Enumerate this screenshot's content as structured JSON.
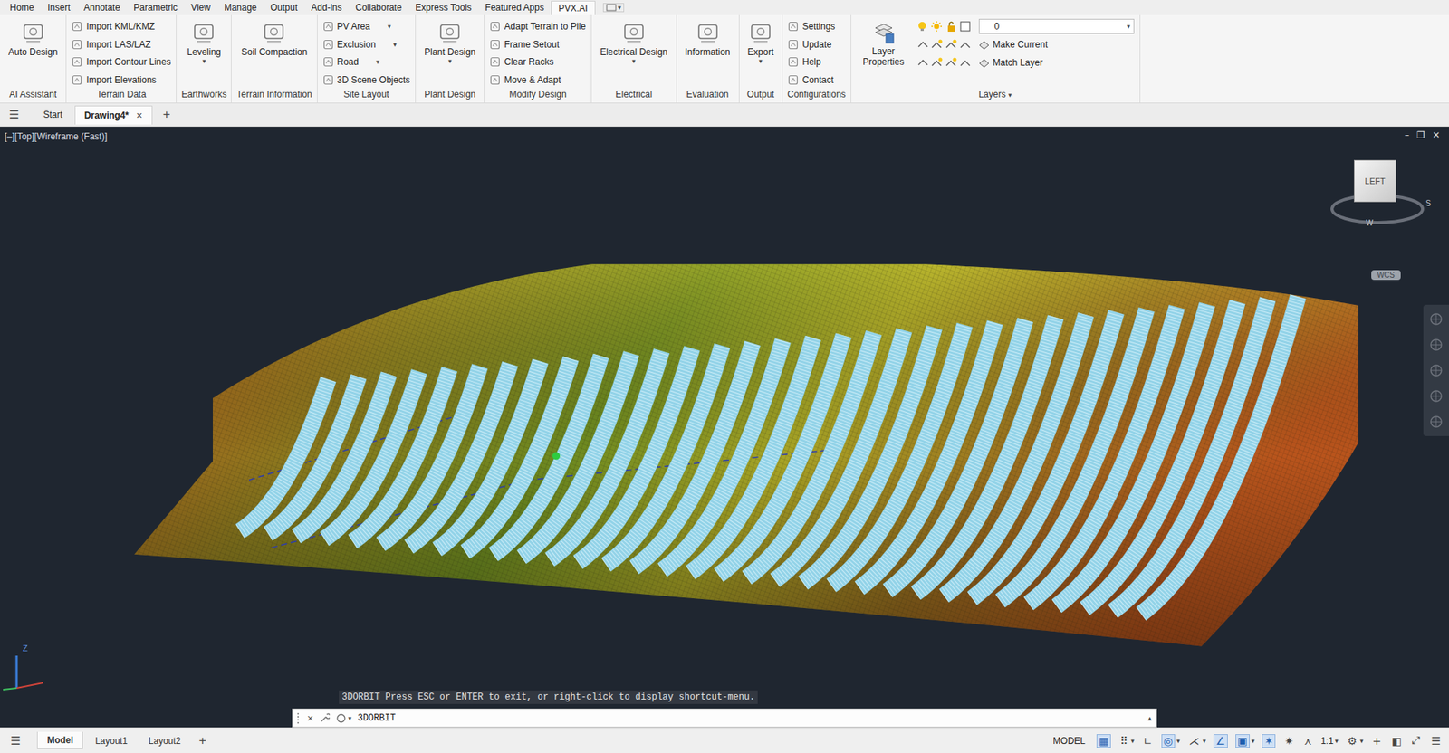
{
  "menu_tabs": [
    {
      "label": "Home",
      "selected": false
    },
    {
      "label": "Insert",
      "selected": false
    },
    {
      "label": "Annotate",
      "selected": false
    },
    {
      "label": "Parametric",
      "selected": false
    },
    {
      "label": "View",
      "selected": false
    },
    {
      "label": "Manage",
      "selected": false
    },
    {
      "label": "Output",
      "selected": false
    },
    {
      "label": "Add-ins",
      "selected": false
    },
    {
      "label": "Collaborate",
      "selected": false
    },
    {
      "label": "Express Tools",
      "selected": false
    },
    {
      "label": "Featured Apps",
      "selected": false
    },
    {
      "label": "PVX.AI",
      "selected": true
    }
  ],
  "menu_extra": "▾",
  "ribbon_groups": [
    {
      "title": "AI Assistant",
      "kind": "large",
      "items": [
        {
          "label": "Auto Design",
          "arrow": ""
        }
      ]
    },
    {
      "title": "Terrain Data",
      "kind": "small",
      "items": [
        {
          "label": "Import KML/KMZ",
          "arrow": ""
        },
        {
          "label": "Import LAS/LAZ",
          "arrow": ""
        },
        {
          "label": "Import Contour Lines",
          "arrow": ""
        },
        {
          "label": "Import Elevations",
          "arrow": ""
        }
      ]
    },
    {
      "title": "Earthworks",
      "kind": "large",
      "items": [
        {
          "label": "Leveling",
          "arrow": "▾"
        }
      ]
    },
    {
      "title": "Terrain Information",
      "kind": "large",
      "items": [
        {
          "label": "Soil Compaction",
          "arrow": ""
        }
      ]
    },
    {
      "title": "Site Layout",
      "kind": "small",
      "items": [
        {
          "label": "PV Area",
          "arrow": "▾"
        },
        {
          "label": "Exclusion",
          "arrow": "▾"
        },
        {
          "label": "Road",
          "arrow": "▾"
        },
        {
          "label": "3D Scene Objects",
          "arrow": ""
        }
      ]
    },
    {
      "title": "Plant Design",
      "kind": "large",
      "items": [
        {
          "label": "Plant Design",
          "arrow": "▾"
        }
      ]
    },
    {
      "title": "Modify Design",
      "kind": "small",
      "items": [
        {
          "label": "Adapt Terrain to Pile",
          "arrow": ""
        },
        {
          "label": "Frame Setout",
          "arrow": ""
        },
        {
          "label": "Clear Racks",
          "arrow": ""
        },
        {
          "label": "Move & Adapt",
          "arrow": ""
        }
      ]
    },
    {
      "title": "Electrical",
      "kind": "large",
      "items": [
        {
          "label": "Electrical Design",
          "arrow": "▾"
        }
      ]
    },
    {
      "title": "Evaluation",
      "kind": "large",
      "items": [
        {
          "label": "Information",
          "arrow": ""
        }
      ]
    },
    {
      "title": "Output",
      "kind": "large",
      "items": [
        {
          "label": "Export",
          "arrow": "▾"
        }
      ]
    },
    {
      "title": "Configurations",
      "kind": "small",
      "items": [
        {
          "label": "Settings",
          "arrow": ""
        },
        {
          "label": "Update",
          "arrow": ""
        },
        {
          "label": "Help",
          "arrow": ""
        },
        {
          "label": "Contact",
          "arrow": ""
        }
      ]
    }
  ],
  "layers_group": {
    "title": "Layers",
    "title_arrow": "▾",
    "properties": "Layer Properties",
    "layer_value": "0",
    "dropdown_arrow": "▾",
    "actions": [
      "Make Current",
      "Match Layer"
    ]
  },
  "doc_tabs": {
    "menu": "☰",
    "tabs": [
      {
        "label": "Start",
        "selected": false,
        "close": ""
      },
      {
        "label": "Drawing4*",
        "selected": true,
        "close": "×"
      }
    ],
    "add": "+"
  },
  "viewport": {
    "label": "[–][Top][Wireframe (Fast)]",
    "controls": [
      "–",
      "❐",
      "✕"
    ],
    "view_cube": "LEFT",
    "compass": [
      "S",
      "W"
    ],
    "wcs": "WCS",
    "ucs_axis": "Z"
  },
  "command_line": {
    "history": "3DORBIT Press ESC or ENTER to exit, or right-click to display shortcut-menu.",
    "close": "×",
    "icon_arrow": "▾",
    "input": "3DORBIT",
    "expand": "▴"
  },
  "status_bar": {
    "menu": "☰",
    "tabs": [
      {
        "label": "Model",
        "selected": true
      },
      {
        "label": "Layout1",
        "selected": false
      },
      {
        "label": "Layout2",
        "selected": false
      }
    ],
    "add": "+",
    "model": "MODEL",
    "toggles": [
      {
        "glyph": "▦",
        "on": true,
        "arrow": ""
      },
      {
        "glyph": "⠿",
        "on": false,
        "arrow": "▾"
      },
      {
        "glyph": "∟",
        "on": false,
        "arrow": ""
      },
      {
        "glyph": "◎",
        "on": true,
        "arrow": "▾"
      },
      {
        "glyph": "⋌",
        "on": false,
        "arrow": "▾"
      },
      {
        "glyph": "∠",
        "on": true,
        "arrow": ""
      },
      {
        "glyph": "▣",
        "on": true,
        "arrow": "▾"
      },
      {
        "glyph": "✶",
        "on": true,
        "arrow": ""
      },
      {
        "glyph": "✷",
        "on": false,
        "arrow": ""
      },
      {
        "glyph": "⋏",
        "on": false,
        "arrow": ""
      }
    ],
    "scale": "1:1",
    "scale_arrow": "▾",
    "tail": [
      {
        "glyph": "⚙",
        "arrow": "▾"
      },
      {
        "glyph": "+",
        "arrow": ""
      },
      {
        "glyph": "◧",
        "arrow": ""
      },
      {
        "glyph": "⤢",
        "arrow": ""
      },
      {
        "glyph": "☰",
        "arrow": ""
      }
    ]
  }
}
